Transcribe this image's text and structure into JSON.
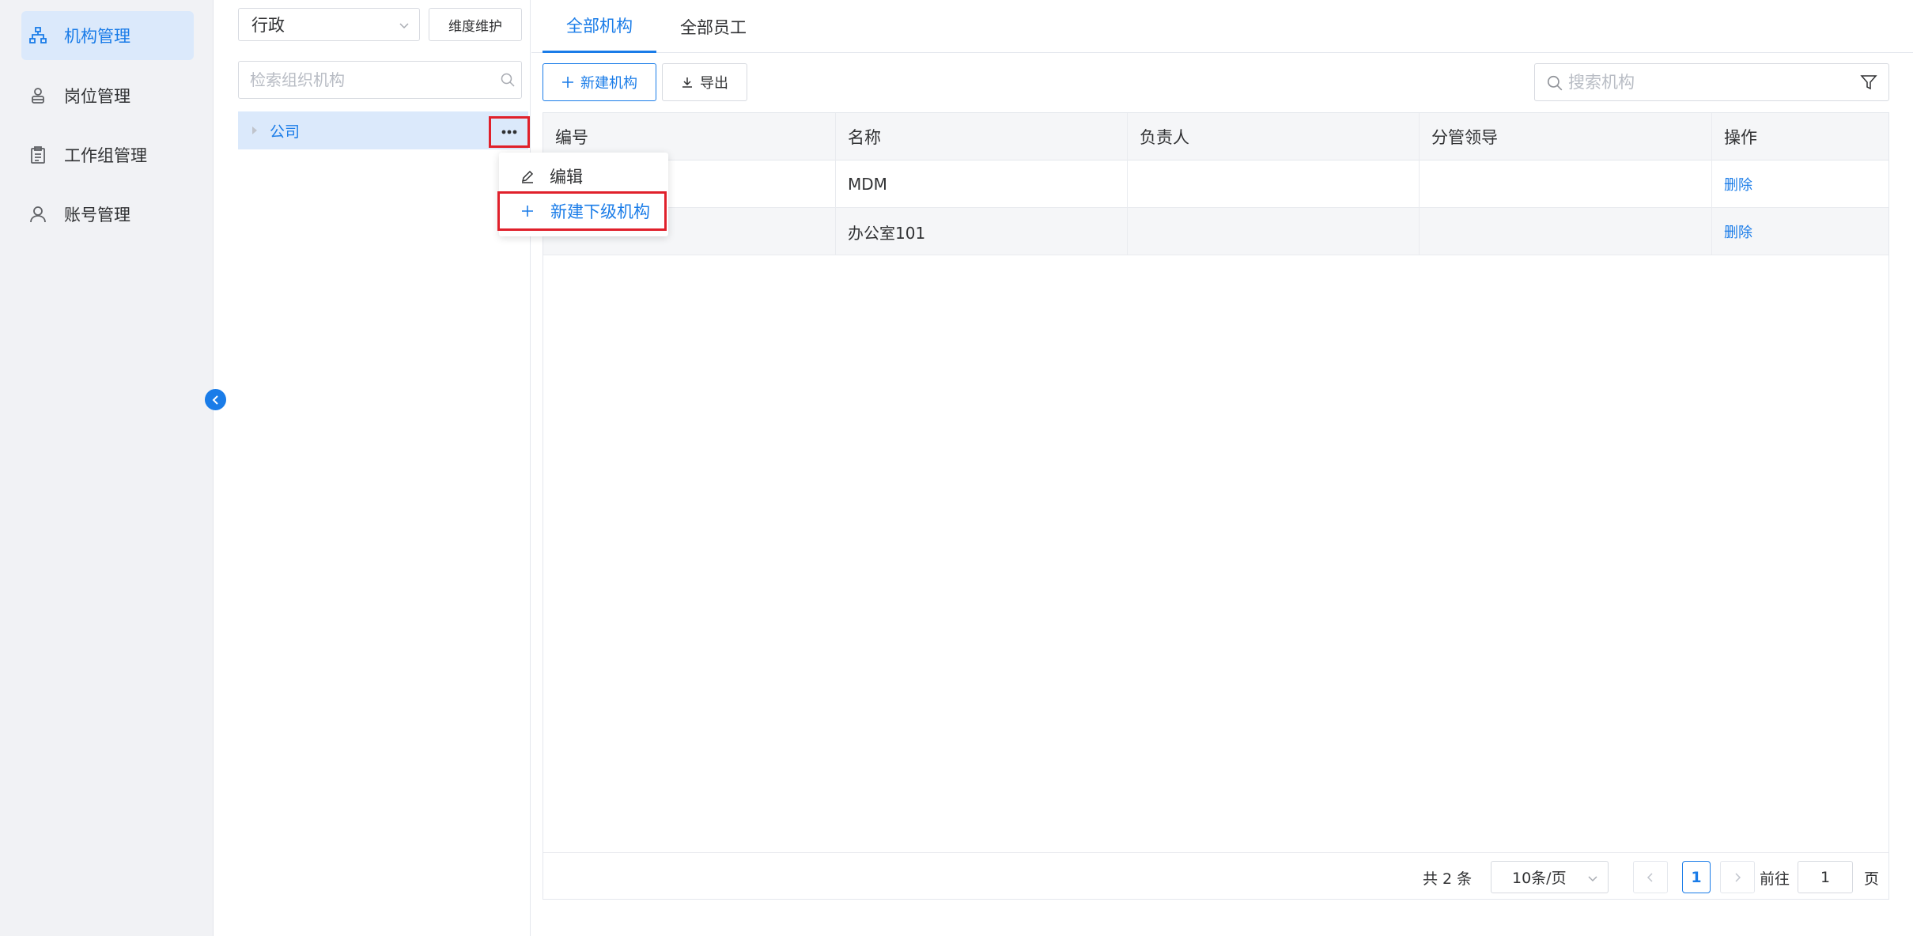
{
  "sidebar": {
    "items": [
      {
        "label": "机构管理",
        "icon": "org-chart-icon",
        "active": true
      },
      {
        "label": "岗位管理",
        "icon": "position-icon",
        "active": false
      },
      {
        "label": "工作组管理",
        "icon": "clipboard-icon",
        "active": false
      },
      {
        "label": "账号管理",
        "icon": "user-icon",
        "active": false
      }
    ]
  },
  "tree": {
    "dimension_value": "行政",
    "dimension_button": "维度维护",
    "search_placeholder": "检索组织机构",
    "node_label": "公司"
  },
  "context_menu": {
    "edit_label": "编辑",
    "add_child_label": "新建下级机构"
  },
  "tabs": [
    {
      "label": "全部机构",
      "active": true
    },
    {
      "label": "全部员工",
      "active": false
    }
  ],
  "toolbar": {
    "new_label": "新建机构",
    "export_label": "导出",
    "search_placeholder": "搜索机构"
  },
  "table": {
    "columns": [
      "编号",
      "名称",
      "负责人",
      "分管领导",
      "操作"
    ],
    "rows": [
      {
        "code": "",
        "name": "MDM",
        "owner": "",
        "leader": "",
        "action": "删除"
      },
      {
        "code": "",
        "name": "办公室101",
        "owner": "",
        "leader": "",
        "action": "删除"
      }
    ]
  },
  "pagination": {
    "total": "共 2 条",
    "page_size": "10条/页",
    "current": "1",
    "goto_label": "前往",
    "goto_value": "1",
    "page_suffix": "页"
  },
  "colors": {
    "accent": "#1a7ce8",
    "highlight_border": "#e0202b",
    "sidebar_bg": "#f1f2f5",
    "active_bg": "#dbe9fb"
  }
}
